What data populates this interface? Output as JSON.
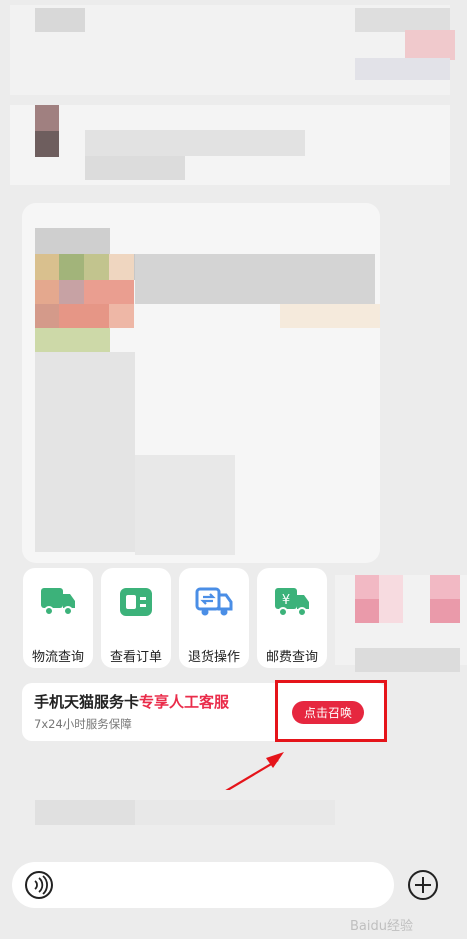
{
  "quick_actions": [
    {
      "label": "物流查询",
      "icon": "truck-icon"
    },
    {
      "label": "查看订单",
      "icon": "order-card-icon"
    },
    {
      "label": "退货操作",
      "icon": "return-truck-icon"
    },
    {
      "label": "邮费查询",
      "icon": "postage-truck-icon"
    }
  ],
  "service_card": {
    "title": "手机天猫服务卡",
    "highlight": "专享人工客服",
    "subtitle": "7x24小时服务保障",
    "button": "点击召唤"
  },
  "watermark": "Baidu经验",
  "colors": {
    "accent_green": "#3cb27a",
    "accent_blue": "#4a8ee6",
    "accent_red": "#e6273f",
    "annotation_red": "#e5141a"
  }
}
